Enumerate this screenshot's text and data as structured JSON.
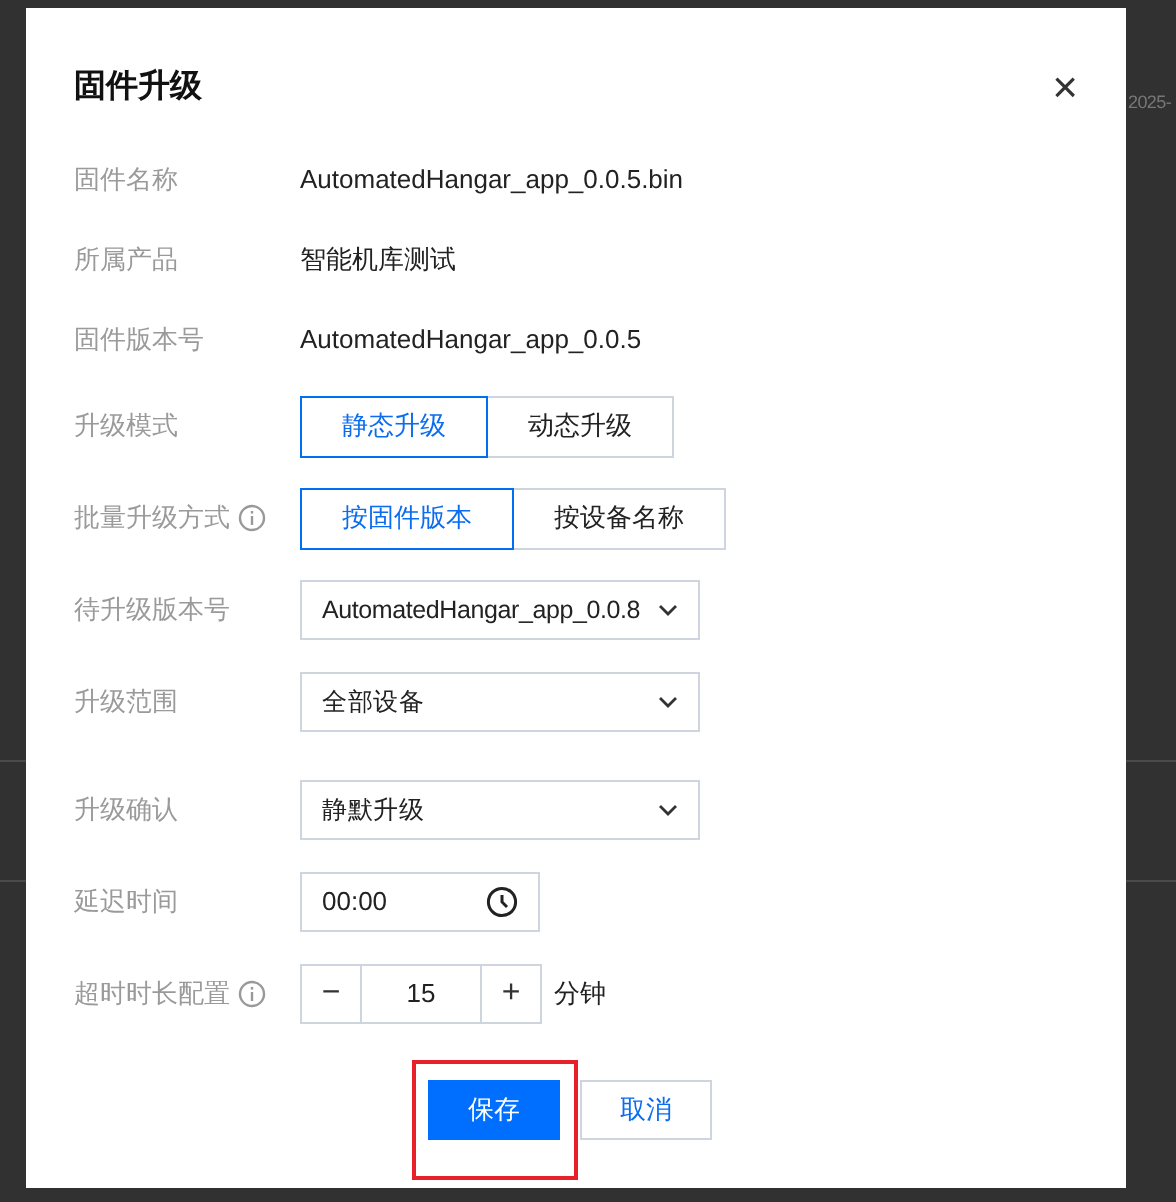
{
  "background": {
    "date_text": "2025-"
  },
  "dialog": {
    "title": "固件升级",
    "close": "×",
    "rows": [
      {
        "kind": "text",
        "label": "固件名称",
        "value": "AutomatedHangar_app_0.0.5.bin"
      },
      {
        "kind": "text",
        "label": "所属产品",
        "value": "智能机库测试"
      },
      {
        "kind": "text",
        "label": "固件版本号",
        "value": "AutomatedHangar_app_0.0.5"
      },
      {
        "kind": "segmented",
        "label": "升级模式",
        "options": [
          {
            "label": "静态升级",
            "selected": true
          },
          {
            "label": "动态升级",
            "selected": false
          }
        ]
      },
      {
        "kind": "segmented",
        "label": "批量升级方式",
        "info": true,
        "options": [
          {
            "label": "按固件版本",
            "selected": true
          },
          {
            "label": "按设备名称",
            "selected": false
          }
        ]
      },
      {
        "kind": "select",
        "label": "待升级版本号",
        "value": "AutomatedHangar_app_0.0.8"
      },
      {
        "kind": "select",
        "label": "升级范围",
        "value": "全部设备"
      },
      {
        "kind": "select",
        "label": "升级确认",
        "value": "静默升级"
      },
      {
        "kind": "time",
        "label": "延迟时间",
        "value": "00:00"
      },
      {
        "kind": "stepper",
        "label": "超时时长配置",
        "info": true,
        "minus": "−",
        "value": "15",
        "plus": "+",
        "unit": "分钟"
      }
    ],
    "buttons": [
      {
        "label": "保存",
        "primary": true,
        "highlighted": true
      },
      {
        "label": "取消",
        "primary": false
      }
    ]
  }
}
